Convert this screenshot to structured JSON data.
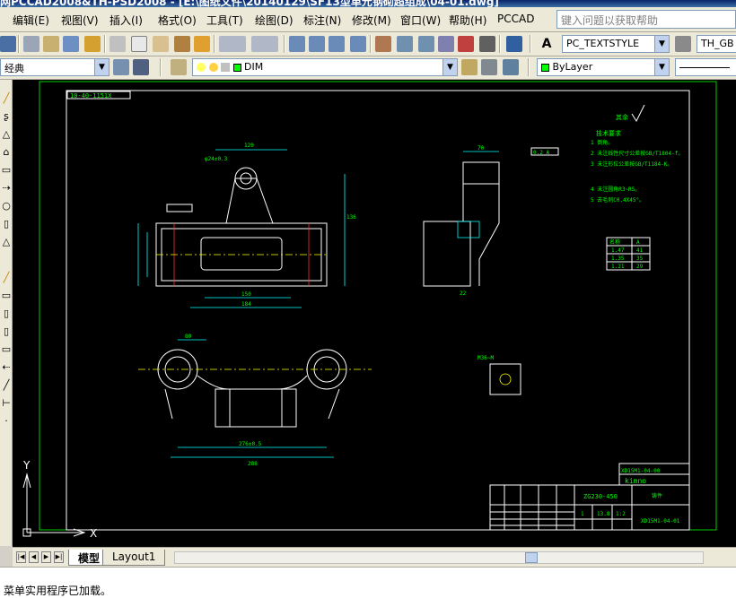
{
  "window": {
    "title": "网PCCAD2008&TH-PSD2008 - [E:\\图纸文件\\20140129\\SF13型单元钢砌超组成\\04-01.dwg]"
  },
  "menu": {
    "items": [
      "编辑(E)",
      "视图(V)",
      "插入(I)",
      "格式(O)",
      "工具(T)",
      "绘图(D)",
      "标注(N)",
      "修改(M)",
      "窗口(W)",
      "帮助(H)",
      "PCCAD"
    ],
    "help_placeholder": "键入问题以获取帮助"
  },
  "toolbar1": {
    "text_style": "PC_TEXTSTYLE",
    "dim_style": "TH_GB"
  },
  "toolbar2": {
    "workspace": "经典",
    "layer": "DIM",
    "color": "ByLayer"
  },
  "drawing": {
    "drawing_number_box": "10-40-1151X",
    "roughness": "其余",
    "tech_req_title": "技术要求",
    "tech_req_lines": [
      "1 倒角。",
      "2 未注线性尺寸公差按GB/T1804-f。",
      "3 未注形位公差按GB/T1184-K。",
      "4 未注圆角R3~R5。",
      "5 去毛刺C0.4X45°。"
    ],
    "table_header": [
      "名称",
      "A"
    ],
    "table_rows": [
      [
        "1.47",
        "41"
      ],
      [
        "1.35",
        "35"
      ],
      [
        "1.21",
        "29"
      ]
    ],
    "dims_top": [
      "120",
      "φ24±0.3",
      "150",
      "184",
      "136"
    ],
    "dims_side": [
      "70",
      "22"
    ],
    "dims_bottom": [
      "80",
      "276±0.5",
      "288"
    ],
    "detail_label": "M36~M",
    "tolerance": "0.2 A",
    "title_block": {
      "drawing_no": "XD15M1-04-00",
      "name": "kimno",
      "material": "ZG230-450",
      "part_no": "XD15M1-04-01",
      "label": "铸件",
      "scale": "1:2",
      "weight": "13.8",
      "units": "1"
    }
  },
  "axes": {
    "x_label": "X",
    "y_label": "Y"
  },
  "tabs": [
    "模型",
    "Layout1"
  ],
  "command": {
    "output": "菜单实用程序已加载。"
  },
  "colors": {
    "drawing_bg": "#000000",
    "line_white": "#ffffff",
    "line_green": "#00ff00",
    "line_cyan": "#00ffff",
    "line_red": "#ff3030",
    "line_yellow": "#ffff00",
    "menu_bg": "#ece9d8"
  }
}
